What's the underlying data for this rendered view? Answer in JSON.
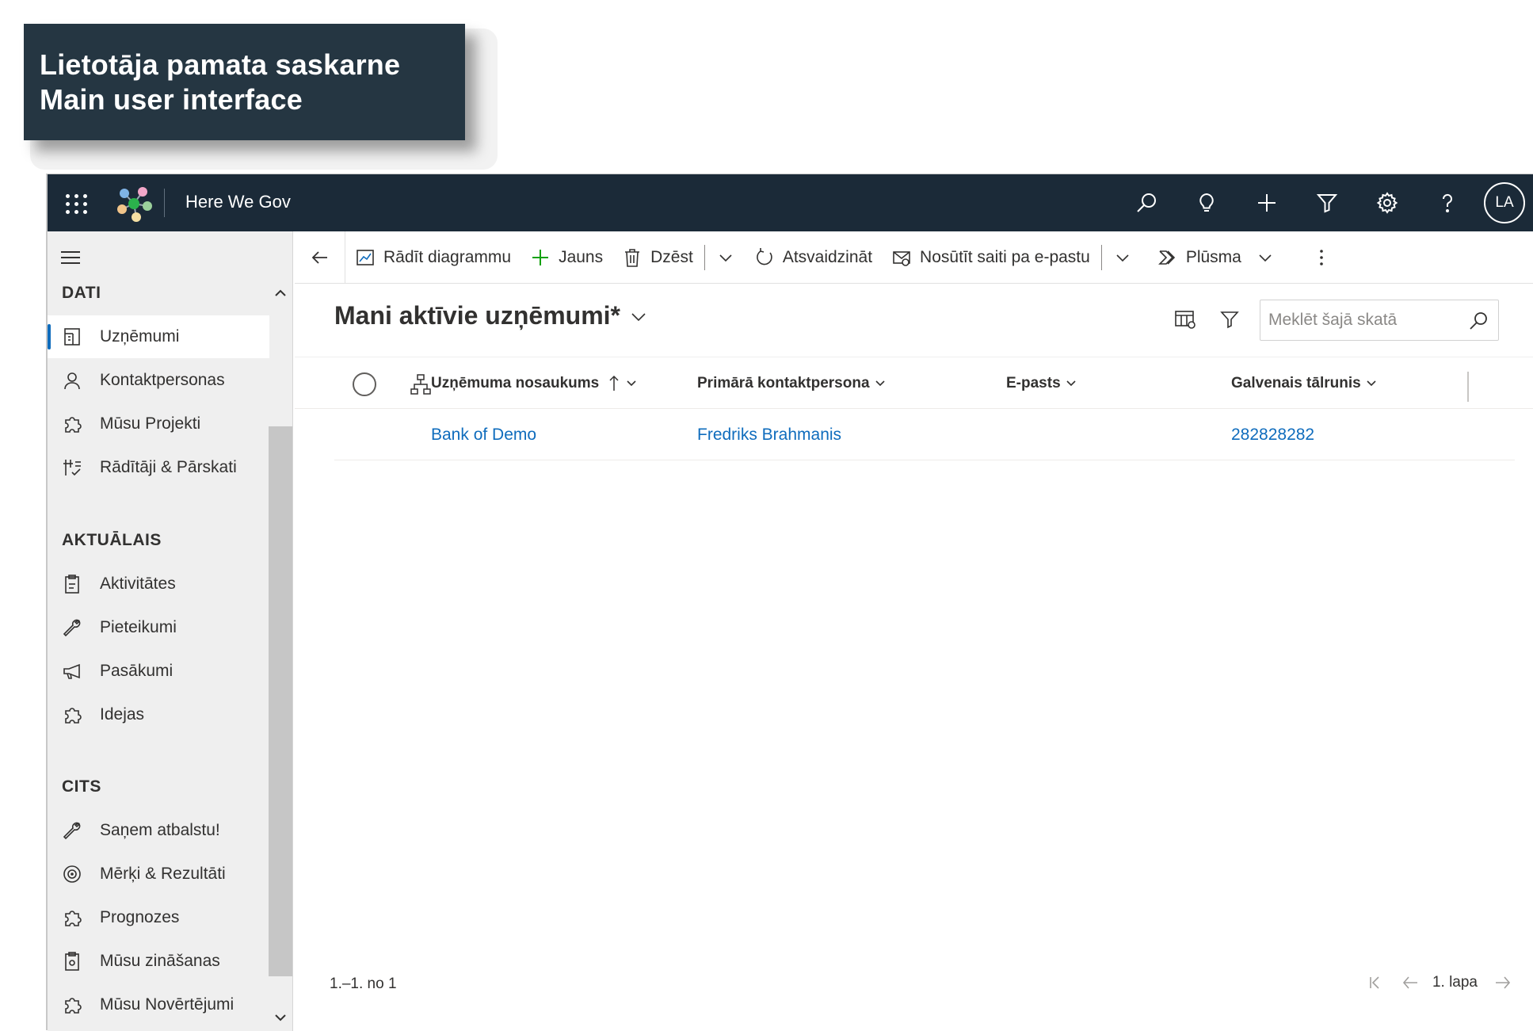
{
  "banner": {
    "line1": "Lietotāja pamata saskarne",
    "line2": "Main user interface"
  },
  "topbar": {
    "app_title": "Here We Gov",
    "icons": [
      "search-icon",
      "lightbulb-icon",
      "plus-icon",
      "filter-icon",
      "gear-icon",
      "help-icon"
    ],
    "avatar_initials": "LA"
  },
  "sidebar": {
    "groups": [
      {
        "title": "DATI",
        "items": [
          {
            "label": "Uzņēmumi",
            "icon": "building-icon",
            "active": true
          },
          {
            "label": "Kontaktpersonas",
            "icon": "person-icon"
          },
          {
            "label": "Mūsu Projekti",
            "icon": "puzzle-icon"
          },
          {
            "label": "Rādītāji & Pārskati",
            "icon": "metrics-icon"
          }
        ]
      },
      {
        "title": "AKTUĀLAIS",
        "items": [
          {
            "label": "Aktivitātes",
            "icon": "clipboard-icon"
          },
          {
            "label": "Pieteikumi",
            "icon": "wrench-icon"
          },
          {
            "label": "Pasākumi",
            "icon": "megaphone-icon"
          },
          {
            "label": "Idejas",
            "icon": "puzzle-icon"
          }
        ]
      },
      {
        "title": "CITS",
        "items": [
          {
            "label": "Saņem atbalstu!",
            "icon": "wrench-icon"
          },
          {
            "label": "Mērķi & Rezultāti",
            "icon": "target-icon"
          },
          {
            "label": "Prognozes",
            "icon": "puzzle-icon"
          },
          {
            "label": "Mūsu zināšanas",
            "icon": "clipboard-icon"
          },
          {
            "label": "Mūsu Novērtējumi",
            "icon": "puzzle-icon"
          }
        ]
      }
    ]
  },
  "commandbar": {
    "show_chart": "Rādīt diagrammu",
    "new": "Jauns",
    "delete": "Dzēst",
    "refresh": "Atsvaidzināt",
    "email_link": "Nosūtīt saiti pa e-pastu",
    "flow": "Plūsma"
  },
  "view": {
    "title": "Mani aktīvie uzņēmumi*",
    "search_placeholder": "Meklēt šajā skatā"
  },
  "grid": {
    "columns": [
      "Uzņēmuma nosaukums",
      "Primārā kontaktpersona",
      "E-pasts",
      "Galvenais tālrunis"
    ],
    "rows": [
      {
        "name": "Bank of Demo",
        "contact": "Fredriks Brahmanis",
        "email": "",
        "phone": "282828282"
      }
    ]
  },
  "footer": {
    "count": "1.–1. no 1",
    "page": "1. lapa"
  },
  "colors": {
    "topbar": "#1b2a38",
    "banner": "#253642",
    "link": "#0f6cbd",
    "sidebar": "#efefef"
  }
}
